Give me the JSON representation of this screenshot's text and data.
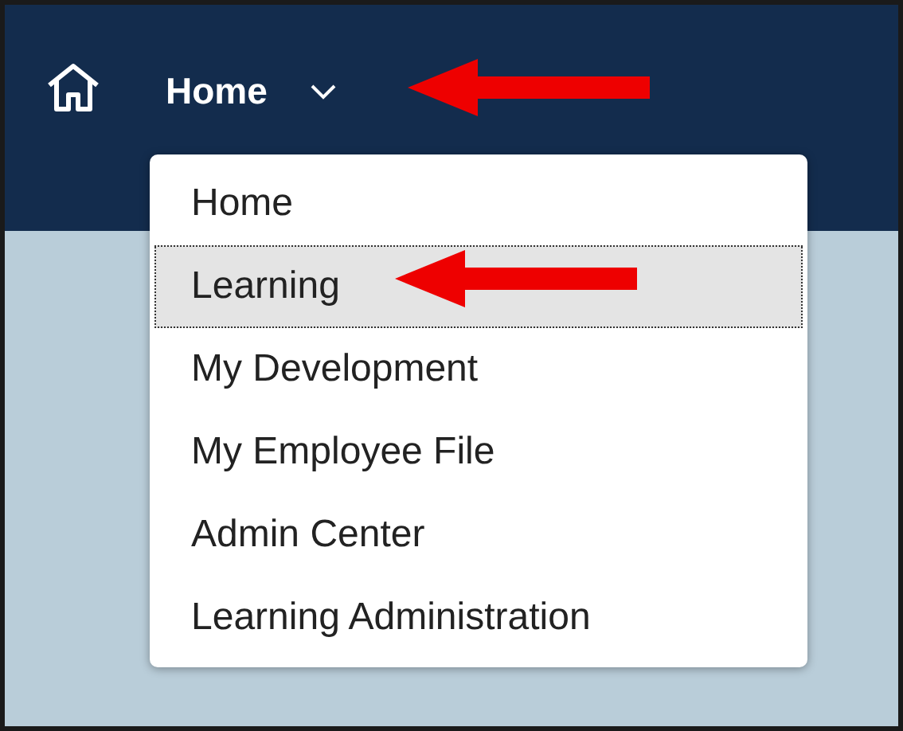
{
  "header": {
    "title": "Home",
    "expanded": true
  },
  "menu": {
    "items": [
      {
        "label": "Home",
        "selected": false
      },
      {
        "label": "Learning",
        "selected": true
      },
      {
        "label": "My Development",
        "selected": false
      },
      {
        "label": "My Employee File",
        "selected": false
      },
      {
        "label": "Admin Center",
        "selected": false
      },
      {
        "label": "Learning Administration",
        "selected": false
      }
    ]
  }
}
